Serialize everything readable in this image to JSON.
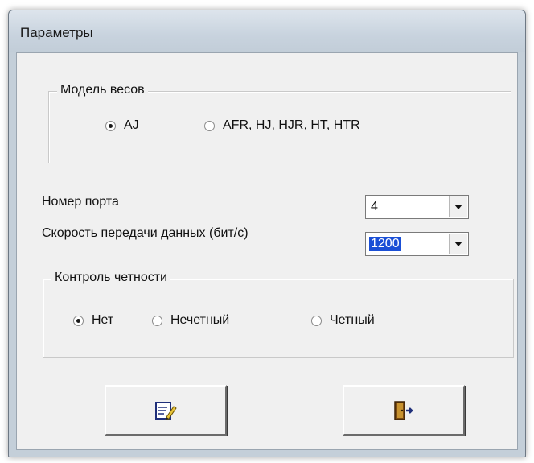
{
  "window": {
    "title": "Параметры"
  },
  "scale_model": {
    "legend": "Модель весов",
    "options": [
      {
        "label": "AJ",
        "checked": true
      },
      {
        "label": "AFR, HJ, HJR, HT, HTR",
        "checked": false
      }
    ]
  },
  "port": {
    "label": "Номер порта",
    "value": "4"
  },
  "baud": {
    "label": "Скорость передачи данных (бит/с)",
    "value": "1200"
  },
  "parity": {
    "legend": "Контроль четности",
    "options": [
      {
        "label": "Нет",
        "checked": true
      },
      {
        "label": "Нечетный",
        "checked": false
      },
      {
        "label": "Четный",
        "checked": false
      }
    ]
  },
  "buttons": {
    "apply_icon": "edit-document-icon",
    "exit_icon": "exit-door-icon"
  }
}
